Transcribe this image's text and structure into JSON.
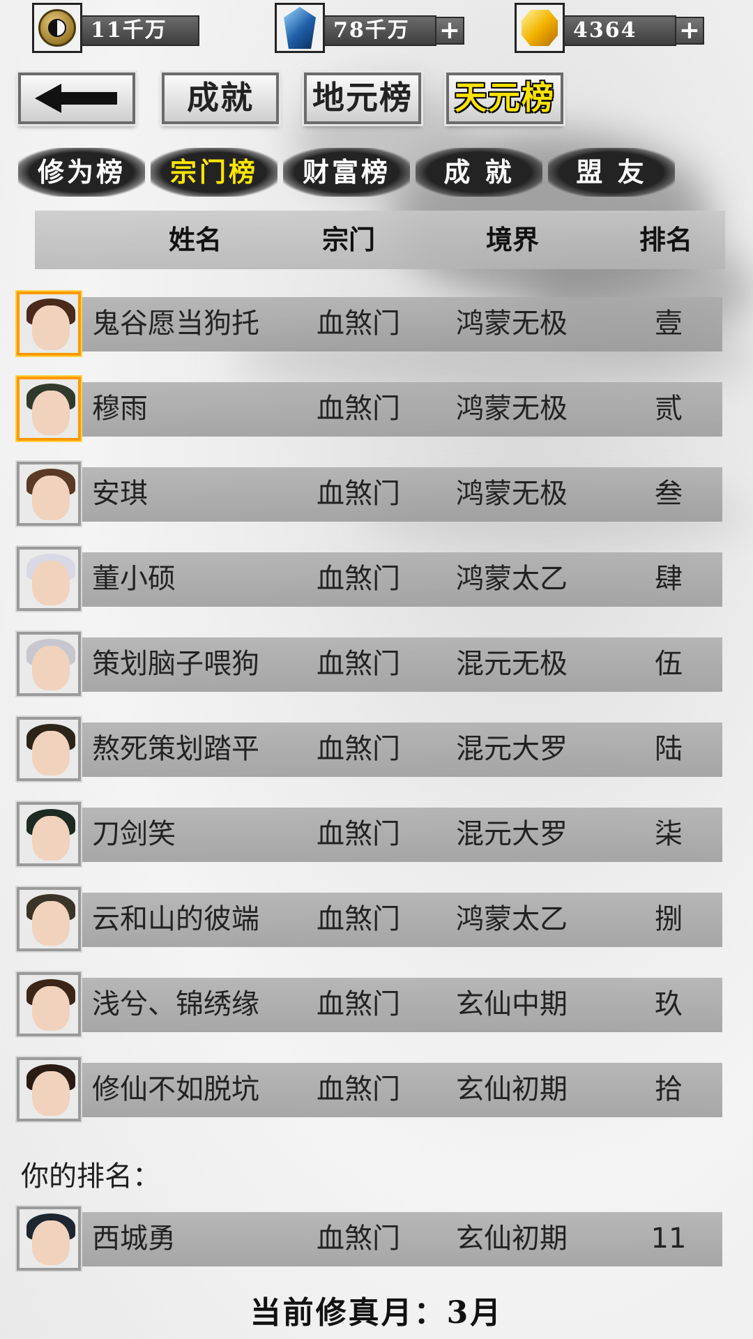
{
  "resources": [
    {
      "icon": "taiji-coin-icon",
      "value": "11千万",
      "has_plus": false
    },
    {
      "icon": "blue-crystal-icon",
      "value": "78千万",
      "has_plus": true
    },
    {
      "icon": "gold-gem-icon",
      "value": "4364",
      "has_plus": true
    }
  ],
  "top_buttons": {
    "back_icon": "back-arrow-icon",
    "achievement": "成就",
    "earth_board": "地元榜",
    "heaven_board": "天元榜",
    "active": "heaven_board"
  },
  "tabs": [
    {
      "label": "修为榜",
      "active": false
    },
    {
      "label": "宗门榜",
      "active": true
    },
    {
      "label": "财富榜",
      "active": false
    },
    {
      "label": "成 就",
      "active": false
    },
    {
      "label": "盟 友",
      "active": false
    }
  ],
  "table": {
    "headers": [
      "姓名",
      "宗门",
      "境界",
      "排名"
    ],
    "rows": [
      {
        "name": "鬼谷愿当狗托",
        "sect": "血煞门",
        "realm": "鸿蒙无极",
        "rank": "壹",
        "frame": "gold",
        "hair": "#4a2a1a"
      },
      {
        "name": "穆雨",
        "sect": "血煞门",
        "realm": "鸿蒙无极",
        "rank": "贰",
        "frame": "gold",
        "hair": "#2f3a2a"
      },
      {
        "name": "安琪",
        "sect": "血煞门",
        "realm": "鸿蒙无极",
        "rank": "叁",
        "frame": "silver",
        "hair": "#5a3a24"
      },
      {
        "name": "董小硕",
        "sect": "血煞门",
        "realm": "鸿蒙太乙",
        "rank": "肆",
        "frame": "silver",
        "hair": "#d9d9e6"
      },
      {
        "name": "策划脑子喂狗",
        "sect": "血煞门",
        "realm": "混元无极",
        "rank": "伍",
        "frame": "silver",
        "hair": "#c7c7cf"
      },
      {
        "name": "熬死策划踏平",
        "sect": "血煞门",
        "realm": "混元大罗",
        "rank": "陆",
        "frame": "silver",
        "hair": "#2c2418"
      },
      {
        "name": "刀剑笑",
        "sect": "血煞门",
        "realm": "混元大罗",
        "rank": "柒",
        "frame": "silver",
        "hair": "#1c2a22"
      },
      {
        "name": "云和山的彼端",
        "sect": "血煞门",
        "realm": "鸿蒙太乙",
        "rank": "捌",
        "frame": "silver",
        "hair": "#3a3428"
      },
      {
        "name": "浅兮、锦绣缘",
        "sect": "血煞门",
        "realm": "玄仙中期",
        "rank": "玖",
        "frame": "silver",
        "hair": "#3b2516"
      },
      {
        "name": "修仙不如脱坑",
        "sect": "血煞门",
        "realm": "玄仙初期",
        "rank": "拾",
        "frame": "silver",
        "hair": "#2a1c14"
      }
    ]
  },
  "your_rank_label": "你的排名：",
  "my_row": {
    "name": "西城勇",
    "sect": "血煞门",
    "realm": "玄仙初期",
    "rank": "11",
    "frame": "silver",
    "hair": "#1e2630"
  },
  "footer": "当前修真月：3月"
}
